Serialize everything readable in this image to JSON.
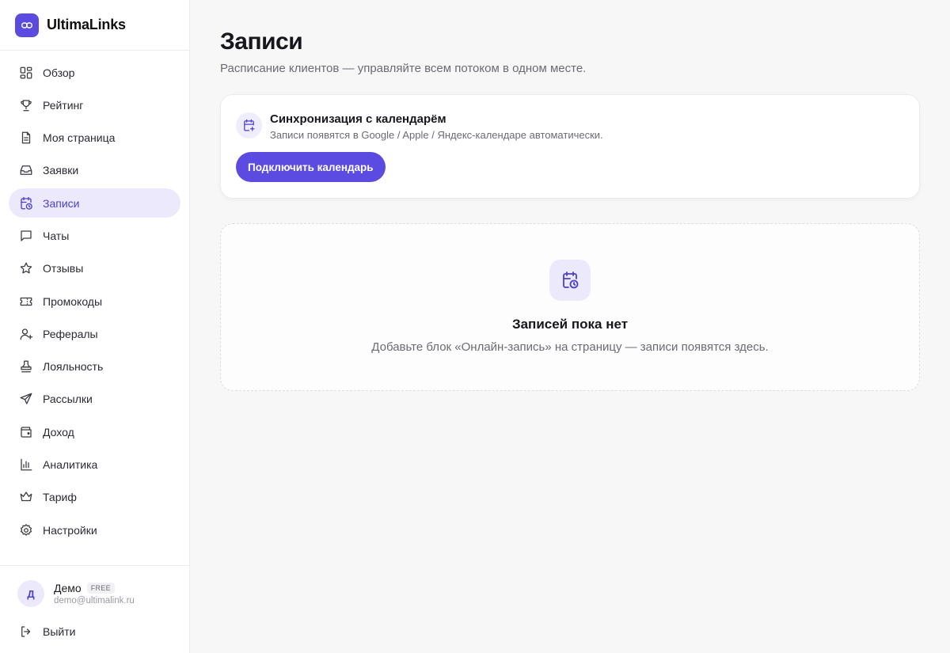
{
  "brand": {
    "name": "UltimaLinks",
    "icon": "link-icon",
    "accent": "#5b4be0"
  },
  "sidebar": {
    "items": [
      {
        "label": "Обзор",
        "icon": "grid-icon",
        "active": false
      },
      {
        "label": "Рейтинг",
        "icon": "trophy-icon",
        "active": false
      },
      {
        "label": "Моя страница",
        "icon": "document-icon",
        "active": false
      },
      {
        "label": "Заявки",
        "icon": "inbox-icon",
        "active": false
      },
      {
        "label": "Записи",
        "icon": "calendar-clock-icon",
        "active": true
      },
      {
        "label": "Чаты",
        "icon": "chat-icon",
        "active": false
      },
      {
        "label": "Отзывы",
        "icon": "star-icon",
        "active": false
      },
      {
        "label": "Промокоды",
        "icon": "ticket-icon",
        "active": false
      },
      {
        "label": "Рефералы",
        "icon": "user-plus-icon",
        "active": false
      },
      {
        "label": "Лояльность",
        "icon": "stamp-icon",
        "active": false
      },
      {
        "label": "Рассылки",
        "icon": "send-icon",
        "active": false
      },
      {
        "label": "Доход",
        "icon": "wallet-icon",
        "active": false
      },
      {
        "label": "Аналитика",
        "icon": "bar-chart-icon",
        "active": false
      },
      {
        "label": "Тариф",
        "icon": "crown-icon",
        "active": false
      },
      {
        "label": "Настройки",
        "icon": "gear-icon",
        "active": false
      }
    ]
  },
  "user": {
    "initial": "Д",
    "name": "Демо",
    "plan": "FREE",
    "email": "demo@ultimalink.ru"
  },
  "logout": {
    "label": "Выйти"
  },
  "main": {
    "title": "Записи",
    "subtitle": "Расписание клиентов — управляйте всем потоком в одном месте.",
    "sync_card": {
      "title": "Синхронизация с календарём",
      "description": "Записи появятся в Google / Apple / Яндекс-календаре автоматически.",
      "button": "Подключить календарь"
    },
    "empty_state": {
      "title": "Записей пока нет",
      "description": "Добавьте блок «Онлайн-запись» на страницу — записи появятся здесь."
    }
  }
}
